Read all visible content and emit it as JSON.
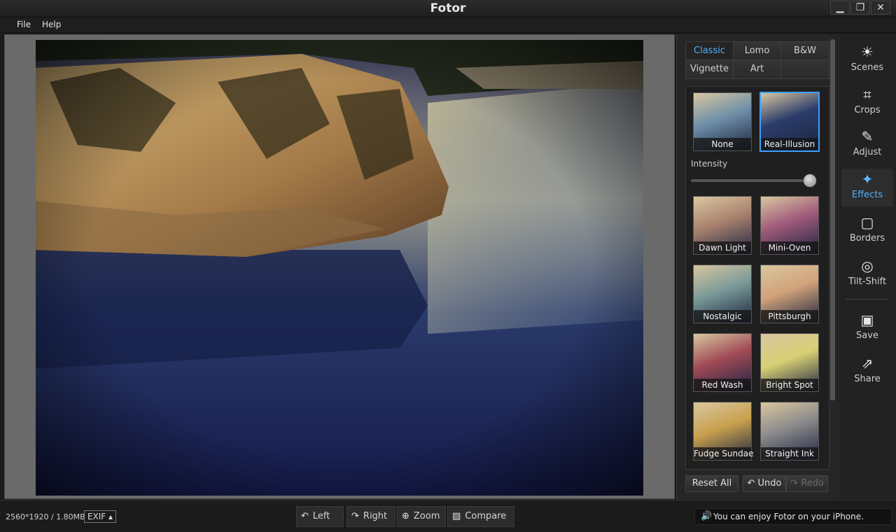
{
  "window": {
    "title": "Fotor",
    "minimize": "▁",
    "maximize": "❐",
    "close": "✕"
  },
  "menu": {
    "file": "File",
    "help": "Help"
  },
  "tabs": [
    {
      "label": "Classic",
      "active": true
    },
    {
      "label": "Lomo",
      "active": false
    },
    {
      "label": "B&W",
      "active": false
    },
    {
      "label": "Vignette",
      "active": false
    },
    {
      "label": "Art",
      "active": false
    }
  ],
  "intensity": {
    "label": "Intensity",
    "value": 1.0
  },
  "effects": [
    {
      "label": "None",
      "selected": false,
      "tint": "#6f8fa8"
    },
    {
      "label": "Real-Illusion",
      "selected": true,
      "tint": "#2b3c6a"
    },
    {
      "label": "Dawn Light",
      "selected": false,
      "tint": "#a9826e"
    },
    {
      "label": "Mini-Oven",
      "selected": false,
      "tint": "#a05a7a"
    },
    {
      "label": "Nostalgic",
      "selected": false,
      "tint": "#7a9a98"
    },
    {
      "label": "Pittsburgh",
      "selected": false,
      "tint": "#d1a27a"
    },
    {
      "label": "Red Wash",
      "selected": false,
      "tint": "#a04a56"
    },
    {
      "label": "Bright Spot",
      "selected": false,
      "tint": "#d7cf74"
    },
    {
      "label": "Fudge Sundae",
      "selected": false,
      "tint": "#c9a04e"
    },
    {
      "label": "Straight Ink",
      "selected": false,
      "tint": "#8a8a8a"
    }
  ],
  "panel_buttons": {
    "reset": "Reset All",
    "undo": "Undo",
    "redo": "Redo"
  },
  "nav": [
    {
      "label": "Scenes",
      "icon": "☀",
      "active": false
    },
    {
      "label": "Crops",
      "icon": "⌗",
      "active": false
    },
    {
      "label": "Adjust",
      "icon": "✎",
      "active": false
    },
    {
      "label": "Effects",
      "icon": "✦",
      "active": true
    },
    {
      "label": "Borders",
      "icon": "▢",
      "active": false
    },
    {
      "label": "Tilt-Shift",
      "icon": "◎",
      "active": false
    },
    {
      "label": "Save",
      "icon": "▣",
      "active": false
    },
    {
      "label": "Share",
      "icon": "⇗",
      "active": false
    }
  ],
  "status": {
    "dims": "2560*1920 / 1.80MB",
    "exif": "EXIF ▴",
    "tools": [
      {
        "label": "Left",
        "icon": "↶"
      },
      {
        "label": "Right",
        "icon": "↷"
      },
      {
        "label": "Zoom",
        "icon": "⊕"
      },
      {
        "label": "Compare",
        "icon": "▨"
      }
    ],
    "promo": "You can enjoy Fotor on your iPhone.",
    "promo_icon": "🔊"
  },
  "colors": {
    "accent": "#3aa0ff",
    "panel": "#262626",
    "canvas": "#6a6a6a"
  }
}
